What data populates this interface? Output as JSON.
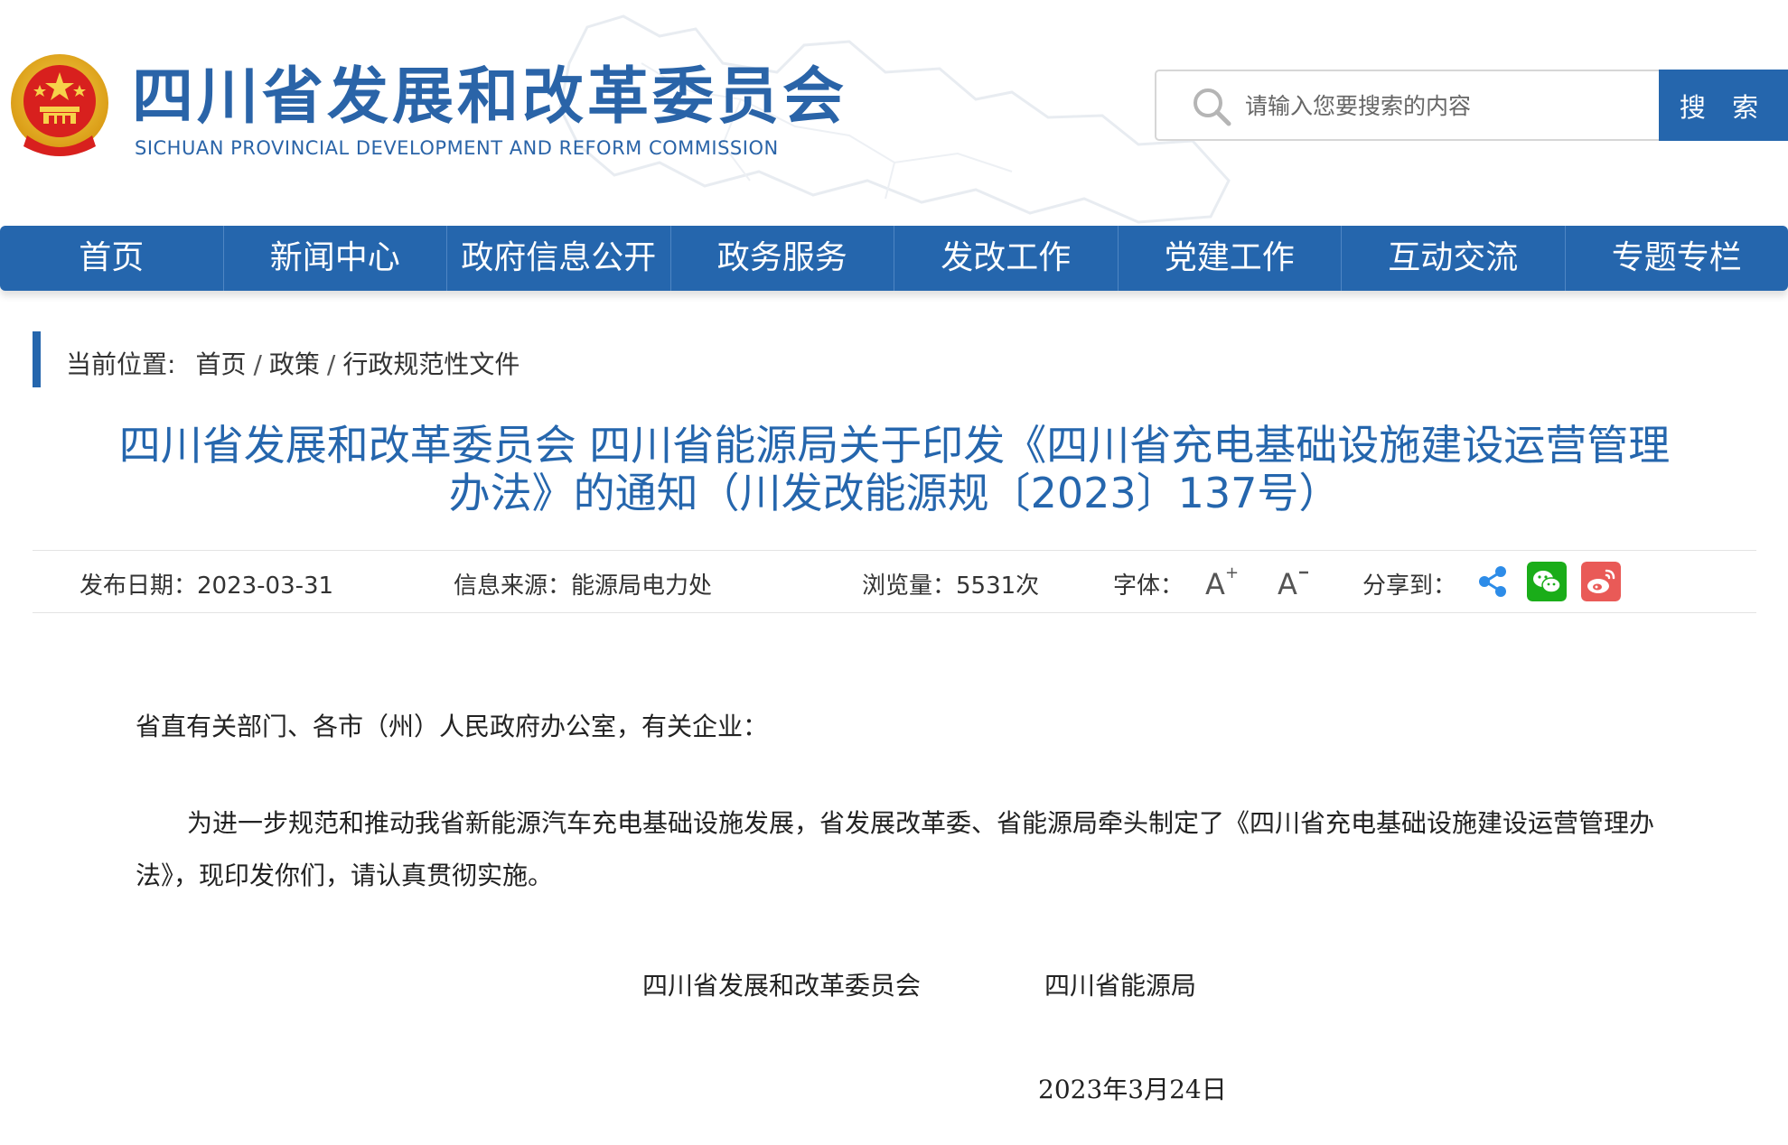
{
  "header": {
    "title": "四川省发展和改革委员会",
    "subtitle": "SICHUAN PROVINCIAL DEVELOPMENT AND REFORM COMMISSION",
    "logo_icon": "national-emblem-icon"
  },
  "search": {
    "placeholder": "请输入您要搜索的内容",
    "button_label": "搜 索"
  },
  "nav": {
    "items": [
      "首页",
      "新闻中心",
      "政府信息公开",
      "政务服务",
      "发改工作",
      "党建工作",
      "互动交流",
      "专题专栏"
    ]
  },
  "breadcrumb": {
    "label": "当前位置:",
    "items": [
      "首页",
      "政策",
      "行政规范性文件"
    ]
  },
  "article": {
    "title": "四川省发展和改革委员会 四川省能源局关于印发《四川省充电基础设施建设运营管理办法》的通知（川发改能源规〔2023〕137号）",
    "meta": {
      "date": "发布日期：2023-03-31",
      "source": "信息来源：能源局电力处",
      "views": "浏览量：5531次",
      "font_label": "字体：",
      "font_larger": "A+",
      "font_smaller": "A-",
      "share_label": "分享到：",
      "share_icons": [
        "share-icon",
        "wechat-icon",
        "weibo-icon"
      ]
    },
    "salutation": "省直有关部门、各市（州）人民政府办公室，有关企业：",
    "paragraph": "为进一步规范和推动我省新能源汽车充电基础设施发展，省发展改革委、省能源局牵头制定了《四川省充电基础设施建设运营管理办法》，现印发你们，请认真贯彻实施。",
    "signature_1": "四川省发展和改革委员会",
    "signature_2": "四川省能源局",
    "signature_date": "2023年3月24日"
  },
  "colors": {
    "brand_blue": "#2566ad",
    "title_blue": "#2a64a8",
    "wechat_green": "#1aad19",
    "weibo_red": "#e95a57"
  }
}
